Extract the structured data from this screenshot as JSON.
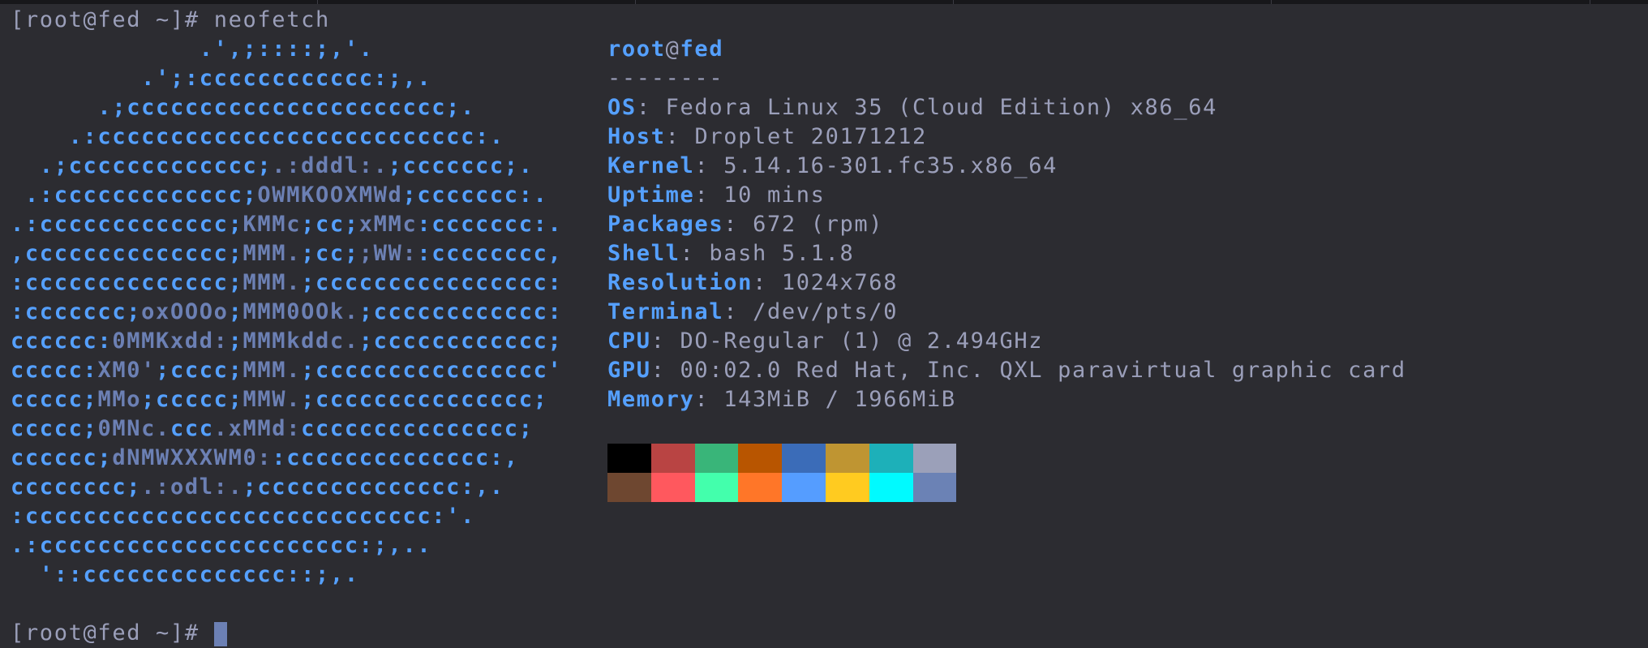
{
  "first_prompt": {
    "prompt": "[root@fed ~]# ",
    "command": "neofetch"
  },
  "second_prompt": {
    "prompt": "[root@fed ~]# "
  },
  "colors": {
    "background": "#2c2c31",
    "logo_primary": "#55a0ff",
    "logo_secondary": "#6c80b4",
    "text": "#9b9fba",
    "cursor": "#6c80b4"
  },
  "art": {
    "lines": [
      [
        {
          "t": "             .',;::::;,'.",
          "c": 1
        }
      ],
      [
        {
          "t": "         .';:cccccccccccc:;,.",
          "c": 1
        }
      ],
      [
        {
          "t": "      .;cccccccccccccccccccccc;.",
          "c": 1
        }
      ],
      [
        {
          "t": "    .:cccccccccccccccccccccccccc:.",
          "c": 1
        }
      ],
      [
        {
          "t": "  .;ccccccccccccc;",
          "c": 1
        },
        {
          "t": ".:dddl:.",
          "c": 2
        },
        {
          "t": ";ccccccc;.",
          "c": 1
        }
      ],
      [
        {
          "t": " .:ccccccccccccc;",
          "c": 1
        },
        {
          "t": "OWMKOOXMWd",
          "c": 2
        },
        {
          "t": ";ccccccc:.",
          "c": 1
        }
      ],
      [
        {
          "t": ".:ccccccccccccc;",
          "c": 1
        },
        {
          "t": "KMMc",
          "c": 2
        },
        {
          "t": ";cc;",
          "c": 1
        },
        {
          "t": "xMMc",
          "c": 2
        },
        {
          "t": ":ccccccc:.",
          "c": 1
        }
      ],
      [
        {
          "t": ",cccccccccccccc;",
          "c": 1
        },
        {
          "t": "MMM.",
          "c": 2
        },
        {
          "t": ";cc;",
          "c": 1
        },
        {
          "t": ";WW:",
          "c": 2
        },
        {
          "t": ":cccccccc,",
          "c": 1
        }
      ],
      [
        {
          "t": ":cccccccccccccc;",
          "c": 1
        },
        {
          "t": "MMM.",
          "c": 2
        },
        {
          "t": ";cccccccccccccccc:",
          "c": 1
        }
      ],
      [
        {
          "t": ":ccccccc;",
          "c": 1
        },
        {
          "t": "oxOOOo",
          "c": 2
        },
        {
          "t": ";",
          "c": 1
        },
        {
          "t": "MMM0OOk.",
          "c": 2
        },
        {
          "t": ";cccccccccccc:",
          "c": 1
        }
      ],
      [
        {
          "t": "cccccc:",
          "c": 1
        },
        {
          "t": "0MMKxdd:",
          "c": 2
        },
        {
          "t": ";",
          "c": 1
        },
        {
          "t": "MMMkddc.",
          "c": 2
        },
        {
          "t": ";cccccccccccc;",
          "c": 1
        }
      ],
      [
        {
          "t": "ccccc:",
          "c": 1
        },
        {
          "t": "XM0'",
          "c": 2
        },
        {
          "t": ";cccc;",
          "c": 1
        },
        {
          "t": "MMM.",
          "c": 2
        },
        {
          "t": ";cccccccccccccccc'",
          "c": 1
        }
      ],
      [
        {
          "t": "ccccc;",
          "c": 1
        },
        {
          "t": "MMo",
          "c": 2
        },
        {
          "t": ";ccccc;",
          "c": 1
        },
        {
          "t": "MMW.",
          "c": 2
        },
        {
          "t": ";ccccccccccccccc;",
          "c": 1
        }
      ],
      [
        {
          "t": "ccccc;",
          "c": 1
        },
        {
          "t": "0MNc.",
          "c": 2
        },
        {
          "t": "ccc",
          "c": 1
        },
        {
          "t": ".xMMd:",
          "c": 2
        },
        {
          "t": "ccccccccccccccc;",
          "c": 1
        }
      ],
      [
        {
          "t": "cccccc;",
          "c": 1
        },
        {
          "t": "dNMWXXXWM0:",
          "c": 2
        },
        {
          "t": ":cccccccccccccc:,",
          "c": 1
        }
      ],
      [
        {
          "t": "cccccccc;",
          "c": 1
        },
        {
          "t": ".:odl:.",
          "c": 2
        },
        {
          "t": ";cccccccccccccc:,.",
          "c": 1
        }
      ],
      [
        {
          "t": ":cccccccccccccccccccccccccccc:'.",
          "c": 1
        }
      ],
      [
        {
          "t": ".:cccccccccccccccccccccc:;,..",
          "c": 1
        }
      ],
      [
        {
          "t": "  '::cccccccccccccc::;,.",
          "c": 1
        }
      ]
    ]
  },
  "info": {
    "user": "root",
    "at": "@",
    "host": "fed",
    "underline": "--------",
    "separator": ": ",
    "fields": [
      {
        "key": "OS",
        "value": "Fedora Linux 35 (Cloud Edition) x86_64"
      },
      {
        "key": "Host",
        "value": "Droplet 20171212"
      },
      {
        "key": "Kernel",
        "value": "5.14.16-301.fc35.x86_64"
      },
      {
        "key": "Uptime",
        "value": "10 mins"
      },
      {
        "key": "Packages",
        "value": "672 (rpm)"
      },
      {
        "key": "Shell",
        "value": "bash 5.1.8"
      },
      {
        "key": "Resolution",
        "value": "1024x768"
      },
      {
        "key": "Terminal",
        "value": "/dev/pts/0"
      },
      {
        "key": "CPU",
        "value": "DO-Regular (1) @ 2.494GHz"
      },
      {
        "key": "GPU",
        "value": "00:02.0 Red Hat, Inc. QXL paravirtual graphic card"
      },
      {
        "key": "Memory",
        "value": "143MiB / 1966MiB"
      }
    ]
  },
  "palette": {
    "normal": [
      "#000000",
      "#b94443",
      "#39b579",
      "#b85500",
      "#3b6cb8",
      "#bf9532",
      "#1db0b9",
      "#9ba0b9"
    ],
    "bright": [
      "#6e4730",
      "#ff585e",
      "#43ffac",
      "#ff7628",
      "#559dff",
      "#ffcb20",
      "#00faff",
      "#6b82b5"
    ]
  }
}
